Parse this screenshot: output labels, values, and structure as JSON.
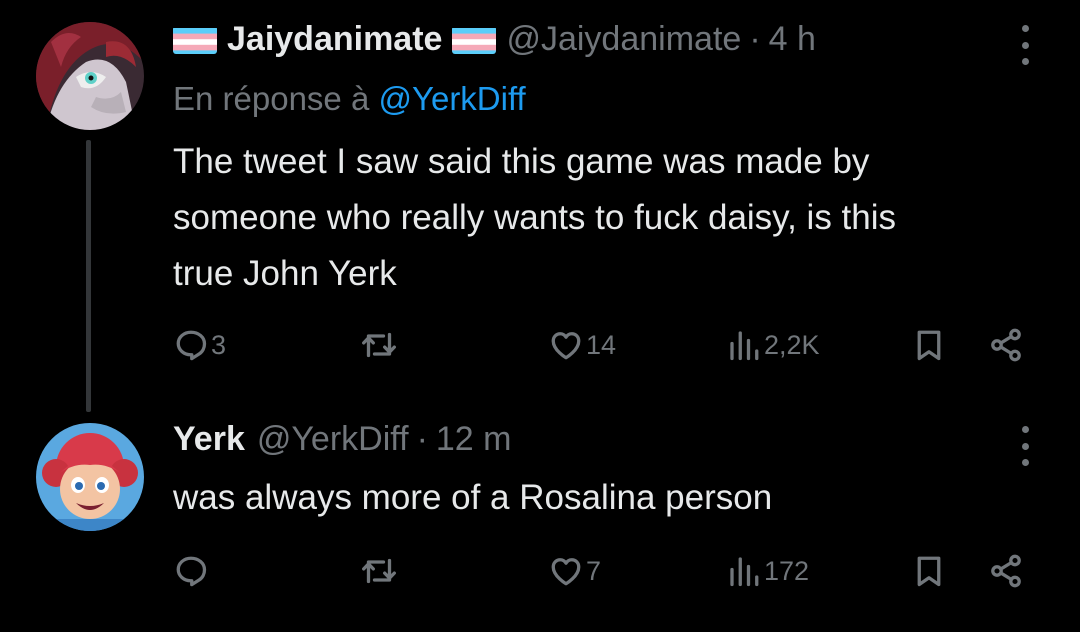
{
  "tweets": [
    {
      "display_name": "Jaiydanimate",
      "handle": "@Jaiydanimate",
      "separator": "·",
      "time": "4 h",
      "reply_prefix": "En réponse à",
      "reply_to": "@YerkDiff",
      "text_lines": [
        "The tweet I saw said this game was made by",
        "someone who really wants to fuck daisy, is this",
        "true John Yerk"
      ],
      "stats": {
        "replies": "3",
        "retweets": "",
        "likes": "14",
        "views": "2,2K"
      }
    },
    {
      "display_name": "Yerk",
      "handle": "@YerkDiff",
      "separator": "·",
      "time": "12 m",
      "text_lines": [
        "was always more of a Rosalina person"
      ],
      "stats": {
        "replies": "",
        "retweets": "",
        "likes": "7",
        "views": "172"
      }
    }
  ],
  "icons": {
    "reply": "reply-icon",
    "retweet": "retweet-icon",
    "like": "heart-icon",
    "views": "views-icon",
    "bookmark": "bookmark-icon",
    "share": "share-icon",
    "more": "more-icon",
    "flag": "trans-flag-icon"
  },
  "colors": {
    "background": "#000000",
    "text": "#e7e9ea",
    "muted": "#71767b",
    "link": "#1d9bf0",
    "thread_line": "#333639"
  }
}
